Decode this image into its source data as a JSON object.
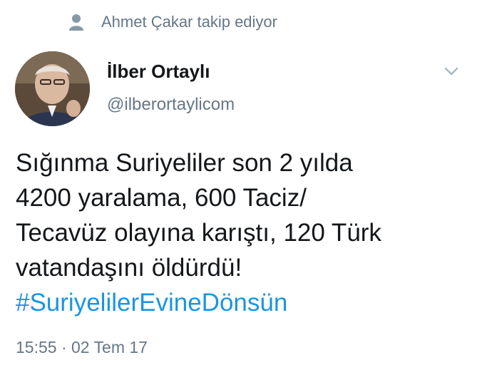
{
  "context": {
    "text": "Ahmet Çakar takip ediyor",
    "icon": "person-icon"
  },
  "author": {
    "name": "İlber Ortaylı",
    "handle": "@ilberortaylicom"
  },
  "menu": {
    "icon": "chevron-down-icon"
  },
  "tweet": {
    "lines": [
      "Sığınma Suriyeliler son 2 yılda",
      "4200 yaralama, 600 Taciz/",
      "Tecavüz olayına karıştı, 120 Türk",
      "vatandaşını öldürdü!"
    ],
    "hashtag": "#SuriyelilerEvineDönsün"
  },
  "timestamp": "15:55 · 02 Tem 17",
  "colors": {
    "link": "#1b95e0",
    "secondary": "#657786",
    "primary": "#14171a"
  }
}
